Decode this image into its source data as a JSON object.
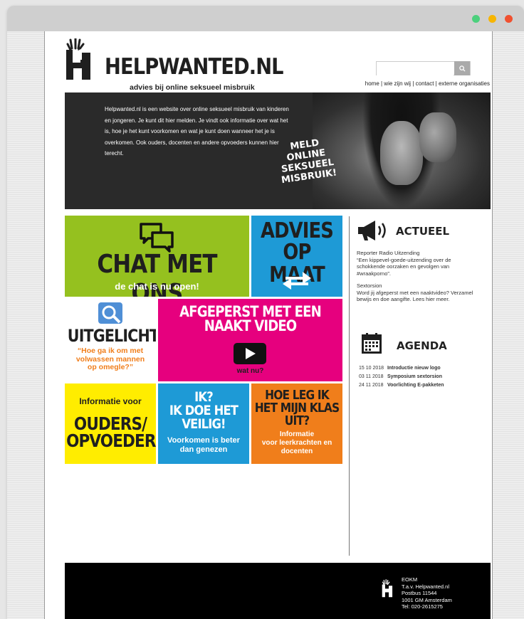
{
  "colors": {
    "green": "#95c11f",
    "blue": "#1e9ad6",
    "magenta": "#e6007e",
    "yellow": "#ffed00",
    "orange": "#f07e1b",
    "dot_green": "#4cd07d",
    "dot_yellow": "#f7b500",
    "dot_red": "#f0502f"
  },
  "logo": {
    "title": "HELPWANTED.NL",
    "tagline": "advies bij online seksueel misbruik"
  },
  "search": {
    "placeholder": ""
  },
  "nav": {
    "home": "home",
    "sep1": " | ",
    "about": "wie zijn wij",
    "sep2": " | ",
    "contact": "contact",
    "sep3": " | ",
    "external": "externe organisaties"
  },
  "hero": {
    "intro": "Helpwanted.nl is een website over online seksueel misbruik van kinderen en jongeren. Je kunt dit hier melden. Je vindt ook informatie over wat het is, hoe je het kunt voorkomen en wat je kunt doen wanneer het je is overkomen. Ook ouders, docenten en andere opvoeders kunnen hier terecht.",
    "meld_line1": "MELD",
    "meld_line2": "ONLINE SEKSUEEL",
    "meld_line3": "MISBRUIK!"
  },
  "tiles": {
    "chat": {
      "title": "CHAT MET ONS",
      "sub": "de chat is nu open!"
    },
    "advies": {
      "line1": "ADVIES",
      "line2": "OP MAAT"
    },
    "uitgelicht": {
      "title": "UITGELICHT",
      "quote": "“Hoe ga ik om met volwassen mannen op omegle?”"
    },
    "afgeperst": {
      "line1": "AFGEPERST MET EEN",
      "line2": "NAAKT VIDEO",
      "sub": "wat nu?"
    },
    "ouders": {
      "pre": "Informatie voor",
      "line1": "OUDERS/",
      "line2": "OPVOEDERS"
    },
    "veilig": {
      "line1": "IK?",
      "line2": "IK DOE HET",
      "line3": "VEILIG!",
      "sub": "Voorkomen is beter dan genezen"
    },
    "klas": {
      "line1": "HOE LEG IK",
      "line2": "HET MIJN KLAS",
      "line3": "UIT?",
      "sub1": "Informatie",
      "sub2": "voor leerkrachten en docenten"
    }
  },
  "actueel": {
    "heading": "ACTUEEL",
    "items": [
      {
        "title": "Reporter Radio Uitzending",
        "text": "“Een kippevel-goede-uitzending over de schokkende oorzaken en gevolgen van #wraakporno”."
      },
      {
        "title": "Sextorsion",
        "text": "Word jij afgeperst met een naaktvideo? Verzamel bewijs en doe aangifte. Lees hier meer."
      }
    ]
  },
  "agenda": {
    "heading": "AGENDA",
    "events": [
      {
        "date": "15 10 2018",
        "title": "Introductie nieuw logo"
      },
      {
        "date": "03 11 2018",
        "title": "Symposium sextorsion"
      },
      {
        "date": "24 11 2018",
        "title": "Voorlichting E-pakketen"
      }
    ]
  },
  "footer": {
    "org": "EOKM",
    "attn": "T.a.v. Helpwanted.nl",
    "box": "Postbus 11544",
    "city": "1001 GM Amsterdam",
    "tel": "Tel: 020-2615275"
  }
}
